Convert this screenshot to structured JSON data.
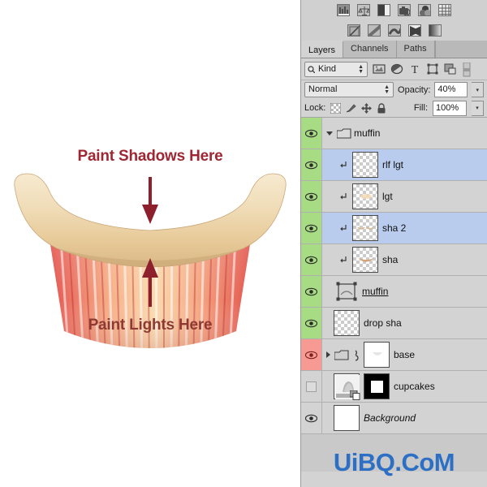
{
  "canvas": {
    "annotation_shadows": "Paint Shadows Here",
    "annotation_lights": "Paint Lights Here",
    "annotation_shadows_color": "#9e2733",
    "annotation_lights_color": "#8e3a33",
    "arrow_color": "#8e1f2c",
    "subject": "cupcake",
    "muffin_top_color": "#ecd3a4",
    "wrapper_color_dark": "#e0453f",
    "wrapper_color_light": "#fbe0b8"
  },
  "panel": {
    "dock_row1_icons": [
      "histogram-icon",
      "color-balance-icon",
      "halftone-icon",
      "camera-icon",
      "color-wheel-icon",
      "grid-icon"
    ],
    "dock_row2_icons": [
      "swatch-icon",
      "gradient-diagonal-icon",
      "gradient-wave-icon",
      "gradient-x-icon",
      "gradient-linear-icon"
    ],
    "tabs": [
      {
        "label": "Layers",
        "active": true
      },
      {
        "label": "Channels",
        "active": false
      },
      {
        "label": "Paths",
        "active": false
      }
    ],
    "filter": {
      "kind_label": "Kind",
      "icons": [
        "pixel-layer-filter-icon",
        "adjustment-layer-filter-icon",
        "type-layer-filter-icon",
        "shape-layer-filter-icon",
        "smart-object-filter-icon",
        "filter-toggle-icon"
      ]
    },
    "blend": {
      "mode": "Normal",
      "opacity_label": "Opacity:",
      "opacity_value": "40%",
      "fill_label": "Fill:",
      "fill_value": "100%"
    },
    "lock": {
      "label": "Lock:",
      "icons": [
        "lock-transparency-icon",
        "lock-image-icon",
        "lock-position-icon",
        "lock-all-icon"
      ]
    },
    "colors": {
      "eye_green": "#a7db84",
      "eye_red": "#f79a94",
      "row_selected": "#b9cced",
      "panel_bg": "#d3d3d3"
    },
    "layers": [
      {
        "name": "muffin",
        "type": "group",
        "visible": true,
        "selected": false,
        "eye_color": "green",
        "indented": false,
        "clipped": false,
        "expanded": true,
        "thumb": "folder",
        "style": "normal"
      },
      {
        "name": "rlf lgt",
        "type": "pixel",
        "visible": true,
        "selected": true,
        "eye_color": "green",
        "indented": true,
        "clipped": true,
        "thumb": "empty",
        "style": "normal"
      },
      {
        "name": "lgt",
        "type": "pixel",
        "visible": true,
        "selected": false,
        "eye_color": "green",
        "indented": true,
        "clipped": true,
        "thumb": "light",
        "style": "normal"
      },
      {
        "name": "sha 2",
        "type": "pixel",
        "visible": true,
        "selected": true,
        "eye_color": "green",
        "indented": true,
        "clipped": true,
        "thumb": "shadow2",
        "style": "normal"
      },
      {
        "name": "sha",
        "type": "pixel",
        "visible": true,
        "selected": false,
        "eye_color": "green",
        "indented": true,
        "clipped": true,
        "thumb": "shadow",
        "style": "normal"
      },
      {
        "name": "muffin",
        "type": "shape",
        "visible": true,
        "selected": false,
        "eye_color": "green",
        "indented": false,
        "clipped": false,
        "thumb": "shape",
        "style": "underline"
      },
      {
        "name": "drop sha",
        "type": "pixel",
        "visible": true,
        "selected": false,
        "eye_color": "green",
        "indented": false,
        "clipped": false,
        "thumb": "empty",
        "style": "normal"
      },
      {
        "name": "base",
        "type": "group",
        "visible": true,
        "selected": false,
        "eye_color": "red",
        "indented": false,
        "clipped": false,
        "expanded": false,
        "thumb": "white-linked",
        "style": "normal"
      },
      {
        "name": "cupcakes",
        "type": "smart-object",
        "visible": false,
        "selected": false,
        "eye_color": "off",
        "indented": false,
        "clipped": false,
        "thumb": "photo-mask",
        "style": "normal"
      },
      {
        "name": "Background",
        "type": "background",
        "visible": true,
        "selected": false,
        "eye_color": "off",
        "indented": false,
        "clipped": false,
        "thumb": "white",
        "style": "italic"
      }
    ]
  },
  "watermark": {
    "text": "UiBQ.CoM",
    "color": "#2c6fc4"
  }
}
